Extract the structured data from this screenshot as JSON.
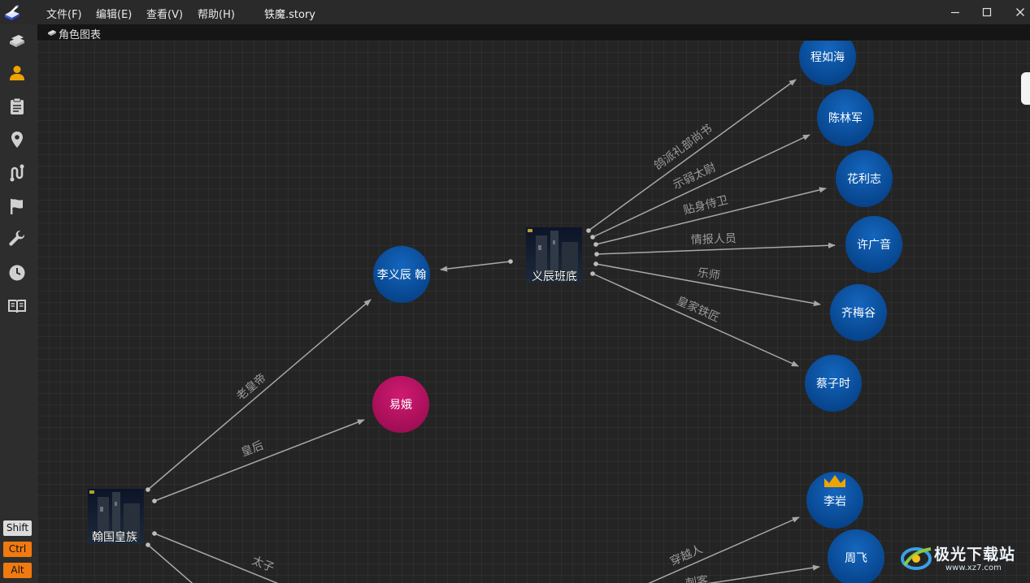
{
  "menubar": {
    "items": [
      {
        "id": "file",
        "label": "文件(F)"
      },
      {
        "id": "edit",
        "label": "编辑(E)"
      },
      {
        "id": "view",
        "label": "查看(V)"
      },
      {
        "id": "help",
        "label": "帮助(H)"
      }
    ],
    "document_title": "铁魔.story"
  },
  "sidebar": {
    "icons": [
      "books-icon",
      "person-icon",
      "clipboard-icon",
      "location-pin-icon",
      "route-icon",
      "flag-icon",
      "wrench-icon",
      "clock-icon",
      "open-book-icon"
    ],
    "active": "person-icon",
    "modifiers": [
      {
        "label": "Shift",
        "color": "#dcdcdc",
        "text_color": "#111111"
      },
      {
        "label": "Ctrl",
        "color": "#f07a10",
        "text_color": "#111111"
      },
      {
        "label": "Alt",
        "color": "#f07a10",
        "text_color": "#111111"
      }
    ]
  },
  "tab": {
    "label": "角色图表",
    "icon": "book-icon"
  },
  "graph": {
    "groups": [
      {
        "id": "hanguo",
        "label": "翰国皇族"
      },
      {
        "id": "yichen",
        "label": "义辰班底"
      }
    ],
    "characters": [
      {
        "id": "liyichen",
        "label": "李义辰 翰",
        "color": "#0a56a6"
      },
      {
        "id": "yie",
        "label": "易娥",
        "color": "#b0125e"
      },
      {
        "id": "chengruhai",
        "label": "程如海",
        "color": "#0a56a6"
      },
      {
        "id": "chenlinjun",
        "label": "陈林军",
        "color": "#0a56a6"
      },
      {
        "id": "hualizhi",
        "label": "花利志",
        "color": "#0a56a6"
      },
      {
        "id": "xuguangyin",
        "label": "许广音",
        "color": "#0a56a6"
      },
      {
        "id": "qimeigu",
        "label": "齐梅谷",
        "color": "#0a56a6"
      },
      {
        "id": "caizishi",
        "label": "蔡子时",
        "color": "#0a56a6"
      },
      {
        "id": "liyan",
        "label": "李岩",
        "color": "#0a56a6",
        "crown": true
      },
      {
        "id": "zhoufei",
        "label": "周飞",
        "color": "#0a56a6"
      }
    ],
    "relations": [
      {
        "from": "hanguo",
        "to": "liyichen",
        "label": "老皇帝"
      },
      {
        "from": "hanguo",
        "to": "yie",
        "label": "皇后"
      },
      {
        "from": "hanguo",
        "to": "offscreen",
        "label": "太子"
      },
      {
        "from": "yichen",
        "to": "liyichen",
        "label": ""
      },
      {
        "from": "yichen",
        "to": "chengruhai",
        "label": "鸽派礼部尚书"
      },
      {
        "from": "yichen",
        "to": "chenlinjun",
        "label": "示弱太尉"
      },
      {
        "from": "yichen",
        "to": "hualizhi",
        "label": "贴身侍卫"
      },
      {
        "from": "yichen",
        "to": "xuguangyin",
        "label": "情报人员"
      },
      {
        "from": "yichen",
        "to": "qimeigu",
        "label": "乐师"
      },
      {
        "from": "yichen",
        "to": "caizishi",
        "label": "皇家铁匠"
      },
      {
        "from": "offscreen",
        "to": "liyan",
        "label": "穿越人"
      },
      {
        "from": "offscreen",
        "to": "zhoufei",
        "label": "刺客"
      }
    ]
  },
  "watermark": {
    "text": "极光下载站",
    "url": "www.xz7.com"
  },
  "colors": {
    "accent_orange": "#f0a400",
    "edge": "#a8a8a8",
    "edge_label": "#9c9c9c"
  }
}
